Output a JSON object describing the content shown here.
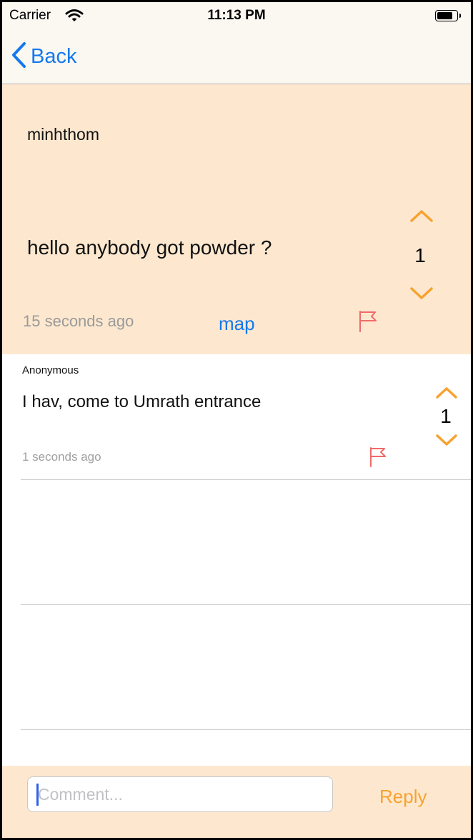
{
  "status_bar": {
    "carrier": "Carrier",
    "time": "11:13 PM"
  },
  "nav": {
    "back_label": "Back"
  },
  "post": {
    "author": "minhthom",
    "body": "hello anybody got powder ?",
    "time": "15 seconds ago",
    "map_label": "map",
    "score": "1"
  },
  "comments": [
    {
      "author": "Anonymous",
      "body": "I hav, come to Umrath entrance",
      "time": "1 seconds ago",
      "score": "1"
    }
  ],
  "reply_bar": {
    "placeholder": "Comment...",
    "value": "",
    "reply_label": "Reply"
  },
  "colors": {
    "accent_orange": "#f7a230",
    "link_blue": "#1479ee",
    "flag_red": "#f06a6a",
    "post_bg": "#fde8cf"
  },
  "icons": [
    "wifi-icon",
    "battery-icon",
    "chevron-left-icon",
    "chevron-up-icon",
    "chevron-down-icon",
    "flag-icon"
  ]
}
